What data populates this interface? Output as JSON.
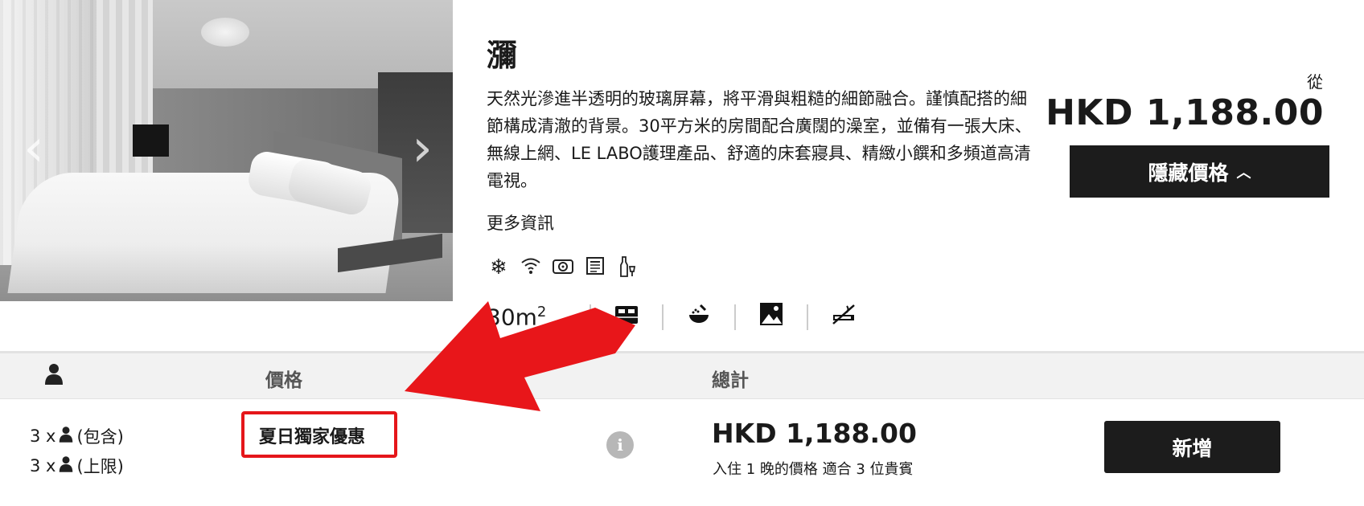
{
  "room": {
    "name": "瀰",
    "description": "天然光滲進半透明的玻璃屏幕，將平滑與粗糙的細節融合。謹慎配搭的細節構成清澈的背景。30平方米的房間配合廣闊的澡室，並備有一張大床、無線上網、LE LABO護理產品、舒適的床套寢具、精緻小饌和多頻道高清電視。",
    "more_info": "更多資訊",
    "size_value": "30m",
    "size_unit_sup": "2",
    "amenity_icons": [
      "snowflake-icon",
      "wifi-icon",
      "safe-icon",
      "newspaper-icon",
      "minibar-icon"
    ],
    "feature_icons": [
      "bed-icon",
      "shower-icon",
      "view-icon",
      "no-smoking-icon"
    ]
  },
  "price_header": {
    "from_label": "從",
    "price": "HKD 1,188.00",
    "hide_button": "隱藏價格"
  },
  "table": {
    "col_price": "價格",
    "col_total": "總計",
    "rows": [
      {
        "occupancy_included": "(包含)",
        "occupancy_max": "(上限)",
        "occupancy_count": "3 x",
        "rate_name": "夏日獨家優惠",
        "total": "HKD 1,188.00",
        "total_note": "入住 1 晚的價格 適合 3 位貴賓",
        "add_button": "新增"
      }
    ]
  },
  "colors": {
    "button_bg": "#1c1c1c",
    "annotation_red": "#e5161a"
  }
}
